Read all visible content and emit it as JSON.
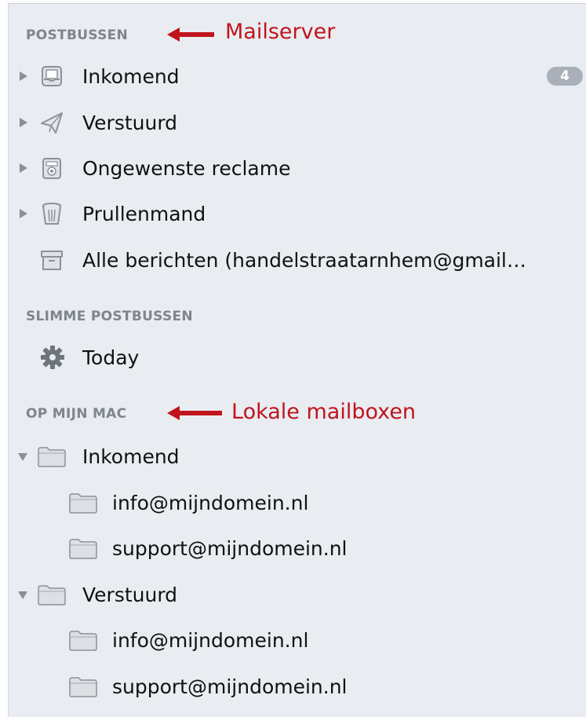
{
  "colors": {
    "sidebar_bg": "#e9ecf1",
    "annotation": "#c0141c",
    "badge": "#a9b0b9"
  },
  "sections": {
    "postbussen": {
      "title": "POSTBUSSEN",
      "items": [
        {
          "label": "Inkomend",
          "icon": "inbox-icon",
          "expanded": false,
          "badge": "4"
        },
        {
          "label": "Verstuurd",
          "icon": "paper-plane-icon",
          "expanded": false
        },
        {
          "label": "Ongewenste reclame",
          "icon": "junk-icon",
          "expanded": false
        },
        {
          "label": "Prullenmand",
          "icon": "trash-icon",
          "expanded": false
        },
        {
          "label": "Alle berichten (handelstraatarnhem@gmail…",
          "icon": "archive-icon"
        }
      ]
    },
    "slimme": {
      "title": "SLIMME POSTBUSSEN",
      "items": [
        {
          "label": "Today",
          "icon": "gear-icon"
        }
      ]
    },
    "mac": {
      "title": "OP MIJN MAC",
      "folders": [
        {
          "label": "Inkomend",
          "expanded": true,
          "children": [
            {
              "label": "info@mijndomein.nl"
            },
            {
              "label": "support@mijndomein.nl"
            }
          ]
        },
        {
          "label": "Verstuurd",
          "expanded": true,
          "children": [
            {
              "label": "info@mijndomein.nl"
            },
            {
              "label": "support@mijndomein.nl"
            }
          ]
        }
      ]
    }
  },
  "annotations": {
    "mailserver": "Mailserver",
    "lokaal": "Lokale mailboxen"
  }
}
